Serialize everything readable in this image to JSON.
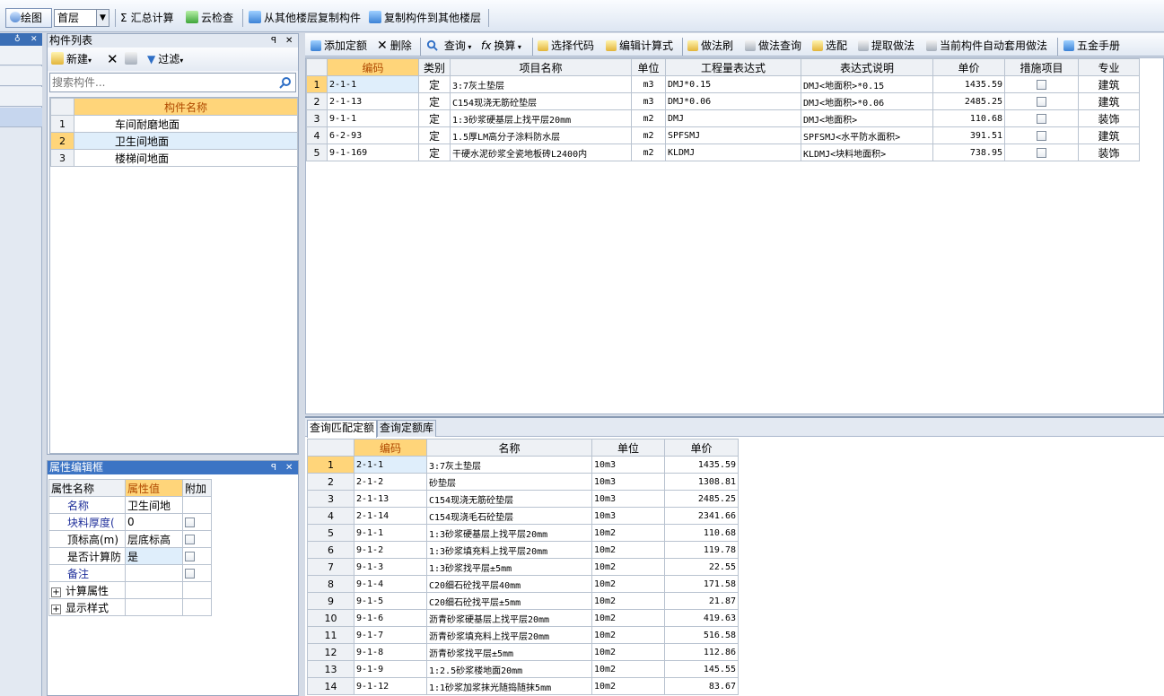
{
  "toolbar": {
    "draw_label": "绘图",
    "floor_value": "首层",
    "sum_label": "汇总计算",
    "cloud_check_label": "云检查",
    "copy_from_label": "从其他楼层复制构件",
    "copy_to_label": "复制构件到其他楼层"
  },
  "component_list": {
    "title": "构件列表",
    "new_label": "新建",
    "filter_label": "过滤",
    "search_placeholder": "搜索构件...",
    "column_header": "构件名称",
    "rows": [
      {
        "no": "1",
        "name": "车间耐磨地面"
      },
      {
        "no": "2",
        "name": "卫生间地面"
      },
      {
        "no": "3",
        "name": "楼梯间地面"
      }
    ]
  },
  "property_panel": {
    "title": "属性编辑框",
    "headers": [
      "属性名称",
      "属性值",
      "附加"
    ],
    "rows": [
      {
        "name": "名称",
        "value": "卫生间地",
        "checkbox": false
      },
      {
        "name": "块料厚度(",
        "value": "0",
        "checkbox": true
      },
      {
        "name": "顶标高(m)",
        "value": "层底标高",
        "checkbox": true
      },
      {
        "name": "是否计算防",
        "value": "是",
        "checkbox": true
      },
      {
        "name": "备注",
        "value": "",
        "checkbox": true
      },
      {
        "name": "计算属性",
        "value": "",
        "checkbox": false,
        "expand": "+"
      },
      {
        "name": "显示样式",
        "value": "",
        "checkbox": false,
        "expand": "+"
      }
    ]
  },
  "quota_toolbar": {
    "add_label": "添加定额",
    "delete_label": "删除",
    "query_label": "查询",
    "convert_label": "换算",
    "select_code_label": "选择代码",
    "edit_formula_label": "编辑计算式",
    "method_brush_label": "做法刷",
    "method_query_label": "做法查询",
    "select_match_label": "选配",
    "extract_label": "提取做法",
    "auto_apply_label": "当前构件自动套用做法",
    "hardware_label": "五金手册"
  },
  "quota_table": {
    "headers": [
      "编码",
      "类别",
      "项目名称",
      "单位",
      "工程量表达式",
      "表达式说明",
      "单价",
      "措施项目",
      "专业"
    ],
    "rows": [
      {
        "no": "1",
        "code": "2-1-1",
        "type": "定",
        "name": "3:7灰土垫层",
        "unit": "m3",
        "expr": "DMJ*0.15",
        "desc": "DMJ<地面积>*0.15",
        "price": "1435.59",
        "measure": false,
        "major": "建筑"
      },
      {
        "no": "2",
        "code": "2-1-13",
        "type": "定",
        "name": "C154现浇无筋砼垫层",
        "unit": "m3",
        "expr": "DMJ*0.06",
        "desc": "DMJ<地面积>*0.06",
        "price": "2485.25",
        "measure": false,
        "major": "建筑"
      },
      {
        "no": "3",
        "code": "9-1-1",
        "type": "定",
        "name": "1:3砂浆硬基层上找平层20mm",
        "unit": "m2",
        "expr": "DMJ",
        "desc": "DMJ<地面积>",
        "price": "110.68",
        "measure": false,
        "major": "装饰"
      },
      {
        "no": "4",
        "code": "6-2-93",
        "type": "定",
        "name": "1.5厚LM高分子涂料防水层",
        "unit": "m2",
        "expr": "SPFSMJ",
        "desc": "SPFSMJ<水平防水面积>",
        "price": "391.51",
        "measure": false,
        "major": "建筑"
      },
      {
        "no": "5",
        "code": "9-1-169",
        "type": "定",
        "name": "干硬水泥砂浆全瓷地板砖L2400内",
        "unit": "m2",
        "expr": "KLDMJ",
        "desc": "KLDMJ<块料地面积>",
        "price": "738.95",
        "measure": false,
        "major": "装饰"
      }
    ]
  },
  "lower_tabs": [
    "查询匹配定额",
    "查询定额库"
  ],
  "library_table": {
    "headers": [
      "编码",
      "名称",
      "单位",
      "单价"
    ],
    "rows": [
      {
        "no": "1",
        "code": "2-1-1",
        "name": "3:7灰土垫层",
        "unit": "10m3",
        "price": "1435.59"
      },
      {
        "no": "2",
        "code": "2-1-2",
        "name": "砂垫层",
        "unit": "10m3",
        "price": "1308.81"
      },
      {
        "no": "3",
        "code": "2-1-13",
        "name": "C154现浇无筋砼垫层",
        "unit": "10m3",
        "price": "2485.25"
      },
      {
        "no": "4",
        "code": "2-1-14",
        "name": "C154现浇毛石砼垫层",
        "unit": "10m3",
        "price": "2341.66"
      },
      {
        "no": "5",
        "code": "9-1-1",
        "name": "1:3砂浆硬基层上找平层20mm",
        "unit": "10m2",
        "price": "110.68"
      },
      {
        "no": "6",
        "code": "9-1-2",
        "name": "1:3砂浆填充料上找平层20mm",
        "unit": "10m2",
        "price": "119.78"
      },
      {
        "no": "7",
        "code": "9-1-3",
        "name": "1:3砂浆找平层±5mm",
        "unit": "10m2",
        "price": "22.55"
      },
      {
        "no": "8",
        "code": "9-1-4",
        "name": "C20细石砼找平层40mm",
        "unit": "10m2",
        "price": "171.58"
      },
      {
        "no": "9",
        "code": "9-1-5",
        "name": "C20细石砼找平层±5mm",
        "unit": "10m2",
        "price": "21.87"
      },
      {
        "no": "10",
        "code": "9-1-6",
        "name": "沥青砂浆硬基层上找平层20mm",
        "unit": "10m2",
        "price": "419.63"
      },
      {
        "no": "11",
        "code": "9-1-7",
        "name": "沥青砂浆填充料上找平层20mm",
        "unit": "10m2",
        "price": "516.58"
      },
      {
        "no": "12",
        "code": "9-1-8",
        "name": "沥青砂浆找平层±5mm",
        "unit": "10m2",
        "price": "112.86"
      },
      {
        "no": "13",
        "code": "9-1-9",
        "name": "1:2.5砂浆楼地面20mm",
        "unit": "10m2",
        "price": "145.55"
      },
      {
        "no": "14",
        "code": "9-1-12",
        "name": "1:1砂浆加浆抹光随捣随抹5mm",
        "unit": "10m2",
        "price": "83.67"
      }
    ]
  }
}
